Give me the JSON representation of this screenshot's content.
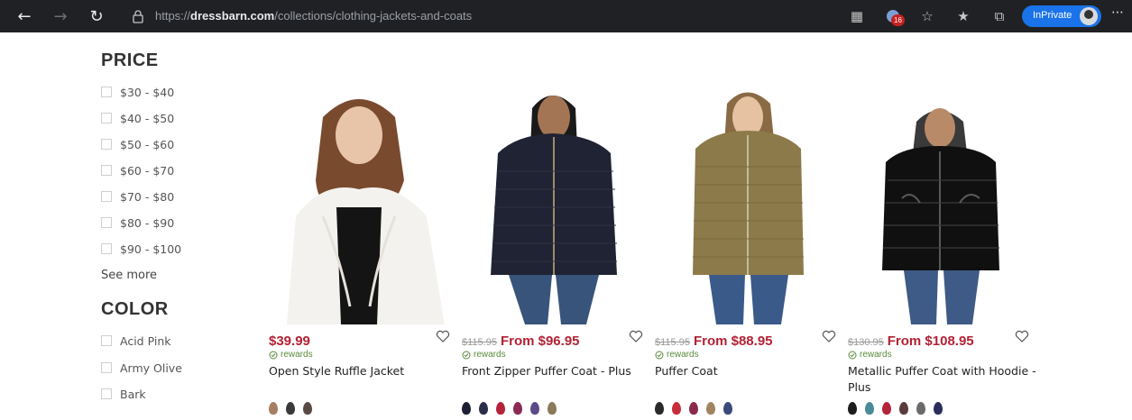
{
  "browser": {
    "url_prefix": "https://",
    "url_domain": "dressbarn.com",
    "url_path": "/collections/clothing-jackets-and-coats",
    "tracking_badge": "16",
    "inprivate_label": "InPrivate"
  },
  "filters": {
    "price_heading": "PRICE",
    "price_options": [
      "$30 - $40",
      "$40 - $50",
      "$50 - $60",
      "$60 - $70",
      "$70 - $80",
      "$80 - $90",
      "$90 - $100"
    ],
    "see_more": "See more",
    "color_heading": "COLOR",
    "color_options": [
      "Acid Pink",
      "Army Olive",
      "Bark"
    ]
  },
  "products": [
    {
      "name": "Open Style Ruffle Jacket",
      "old_price": "",
      "price": "$39.99",
      "rewards": "rewards",
      "swatch_colors": [
        "#a57e63",
        "#3b3a3a",
        "#5a4a45"
      ]
    },
    {
      "name": "Front Zipper Puffer Coat - Plus",
      "old_price": "$115.95",
      "price": "From $96.95",
      "rewards": "rewards",
      "swatch_colors": [
        "#1d2033",
        "#2b2e4a",
        "#b3243a",
        "#8a2a55",
        "#5b4a8a",
        "#8a7a5a"
      ]
    },
    {
      "name": "Puffer Coat",
      "old_price": "$115.95",
      "price": "From $88.95",
      "rewards": "rewards",
      "swatch_colors": [
        "#2a2a2a",
        "#c82d3c",
        "#8a2a4a",
        "#a08560",
        "#3a4a7a"
      ]
    },
    {
      "name": "Metallic Puffer Coat with Hoodie - Plus",
      "old_price": "$130.95",
      "price": "From $108.95",
      "rewards": "rewards",
      "swatch_colors": [
        "#1d1d1d",
        "#4a8a9a",
        "#b3243a",
        "#5a3a3a",
        "#6a6a6a",
        "#2a2e5a"
      ]
    }
  ],
  "colors": {
    "sale_price": "#b22234",
    "rewards": "#5a8a3a",
    "chrome_bg": "#202124",
    "inprivate": "#1a73e8"
  }
}
